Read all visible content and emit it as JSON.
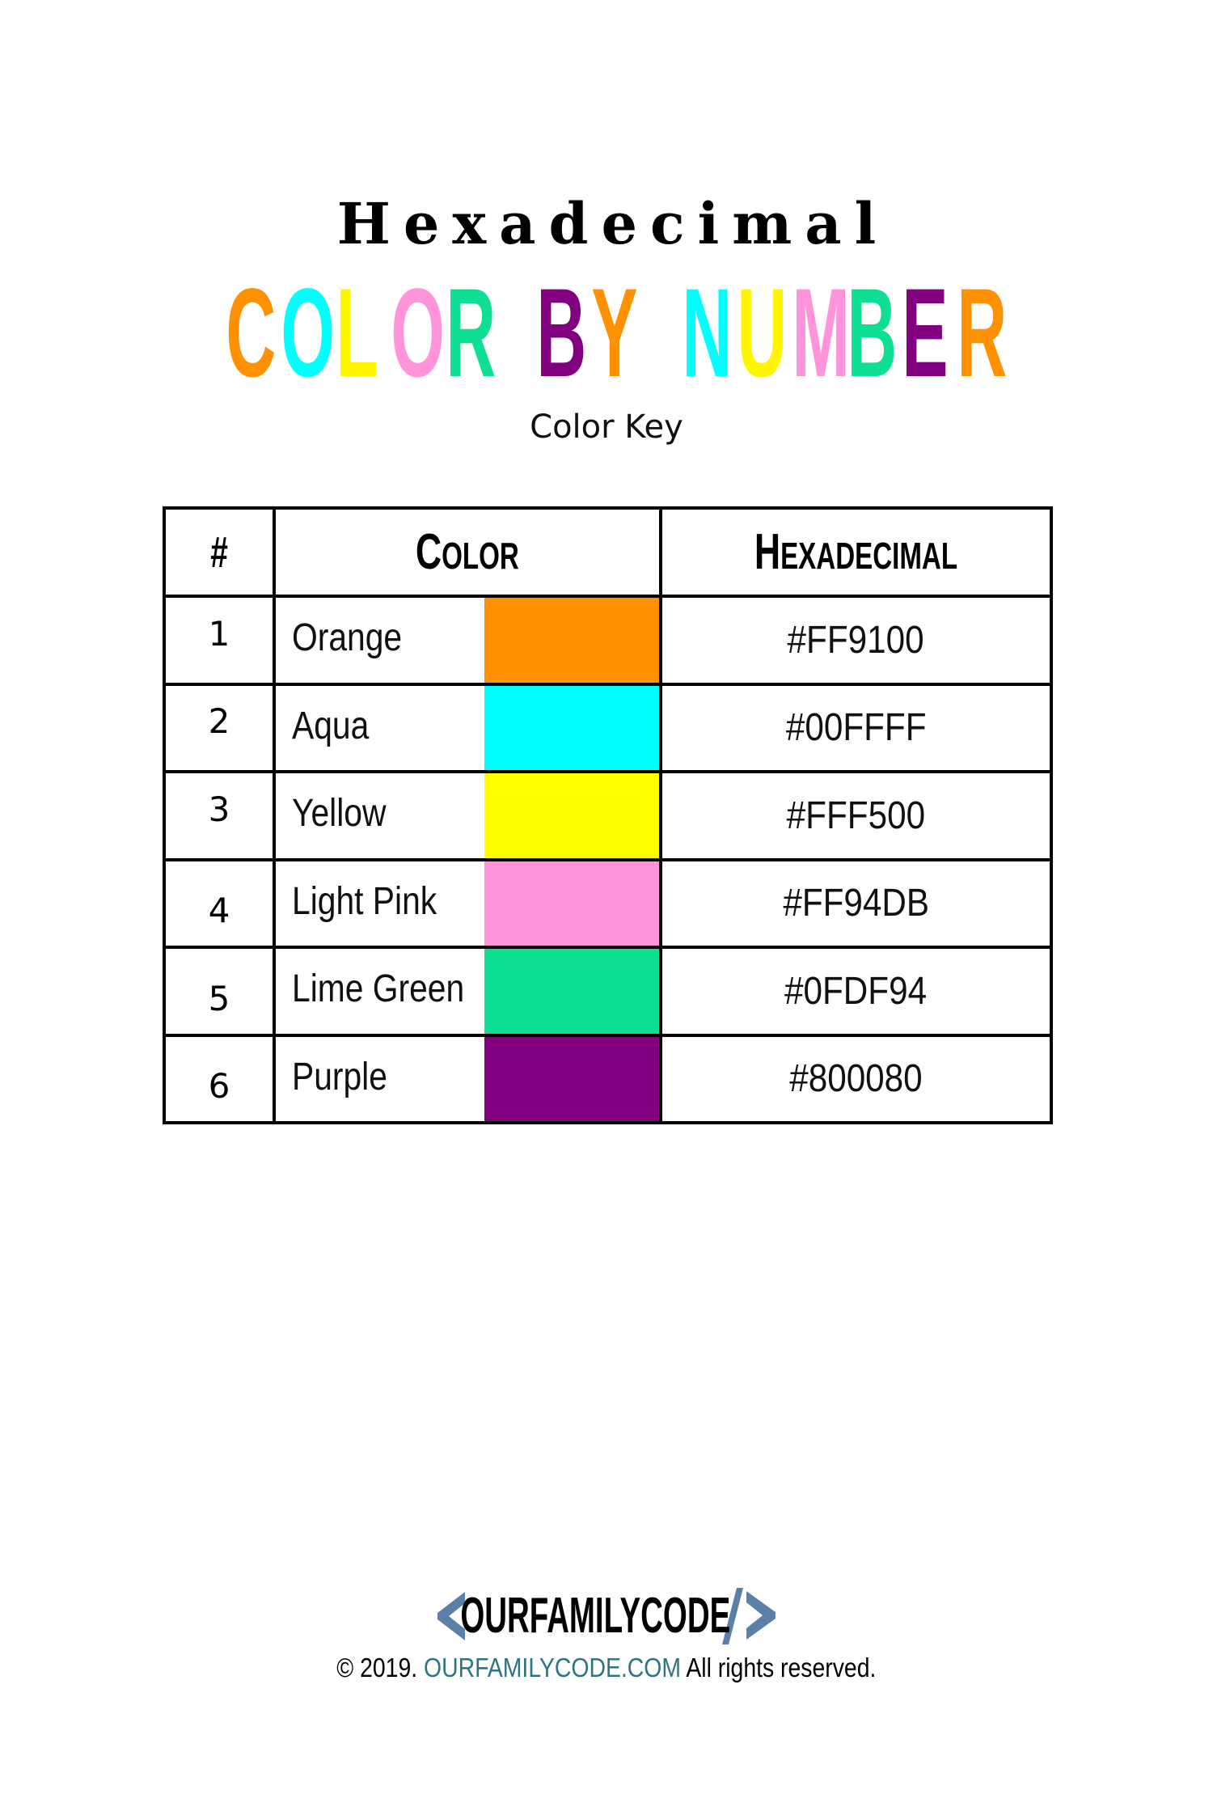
{
  "header": {
    "pre_title": "Hexadecimal",
    "main_title_words": [
      [
        {
          "char": "C",
          "color": "#FF9100"
        },
        {
          "char": "O",
          "color": "#00FFFF"
        },
        {
          "char": "L",
          "color": "#FFF500"
        },
        {
          "char": "O",
          "color": "#FF94DB"
        },
        {
          "char": "R",
          "color": "#0FDF94"
        }
      ],
      [
        {
          "char": "B",
          "color": "#800080"
        },
        {
          "char": "Y",
          "color": "#FF9100"
        }
      ],
      [
        {
          "char": "N",
          "color": "#00FFFF"
        },
        {
          "char": "U",
          "color": "#FFF500"
        },
        {
          "char": "M",
          "color": "#FF94DB"
        },
        {
          "char": "B",
          "color": "#0FDF94"
        },
        {
          "char": "E",
          "color": "#800080"
        },
        {
          "char": "R",
          "color": "#FF9100"
        }
      ]
    ],
    "subtitle": "Color Key"
  },
  "table": {
    "columns": {
      "number": "#",
      "color_first": "C",
      "color_rest": "OLOR",
      "hex_first": "H",
      "hex_rest": "EXADECIMAL"
    },
    "rows": [
      {
        "number": "1",
        "name": "Orange",
        "hex": "#FF9100",
        "swatch": "#FF9100"
      },
      {
        "number": "2",
        "name": "Aqua",
        "hex": "#00FFFF",
        "swatch": "#00FFFF"
      },
      {
        "number": "3",
        "name": "Yellow",
        "hex": "#FFF500",
        "swatch": "#FFFF00"
      },
      {
        "number": "4",
        "name": "Light Pink",
        "hex": "#FF94DB",
        "swatch": "#FF94DB"
      },
      {
        "number": "5",
        "name": "Lime Green",
        "hex": "#0FDF94",
        "swatch": "#0FDF94"
      },
      {
        "number": "6",
        "name": "Purple",
        "hex": "#800080",
        "swatch": "#800080"
      }
    ]
  },
  "footer": {
    "logo_text": "OURFAMILYCODE",
    "logo_icon": "code-brackets-icon",
    "logo_accent_color": "#5A80A8",
    "copyright_symbol": "©",
    "copyright_year": "2019.",
    "copyright_link": "OURFAMILYCODE.COM",
    "copyright_link_color": "#2F7480",
    "copyright_suffix": "All rights reserved."
  }
}
